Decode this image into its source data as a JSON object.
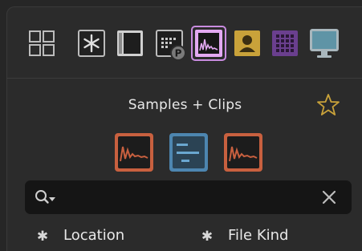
{
  "toolbar": {
    "items": [
      {
        "icon": "grid-view-icon"
      },
      {
        "icon": "asterisk-all-icon"
      },
      {
        "icon": "device-icon"
      },
      {
        "icon": "preset-icon"
      },
      {
        "icon": "samples-clips-icon",
        "selected": true
      },
      {
        "icon": "user-library-icon"
      },
      {
        "icon": "plugin-grid-icon"
      },
      {
        "icon": "monitor-icon"
      }
    ]
  },
  "browser": {
    "title": "Samples + Clips",
    "favorite_icon": "star-icon"
  },
  "filters": [
    {
      "icon": "audio-sample-icon",
      "color": "#c8603f"
    },
    {
      "icon": "note-clip-icon",
      "color": "#4d86b0"
    },
    {
      "icon": "audio-clip-icon",
      "color": "#c8603f"
    }
  ],
  "search": {
    "placeholder": "",
    "value": ""
  },
  "columns": [
    {
      "marker": "✱",
      "label": "Location"
    },
    {
      "marker": "✱",
      "label": "File Kind"
    }
  ],
  "colors": {
    "accent": "#c98ce0",
    "audio": "#c8603f",
    "note": "#4d86b0",
    "user": "#c9a23a",
    "plugin": "#6a3f8e"
  }
}
